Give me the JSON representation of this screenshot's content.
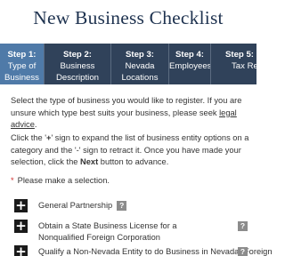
{
  "page": {
    "title": "New Business Checklist"
  },
  "steps": [
    {
      "label": "Step 1:",
      "name": "Type of Business",
      "active": true
    },
    {
      "label": "Step 2:",
      "name": "Business Description",
      "active": false
    },
    {
      "label": "Step 3:",
      "name": "Nevada Locations",
      "active": false
    },
    {
      "label": "Step 4:",
      "name": "Employees",
      "active": false
    },
    {
      "label": "Step 5:",
      "name": "Tax Requirements",
      "active": false
    }
  ],
  "intro": {
    "text": "Select the type of business you would like to register. If you are unsure which type best suits your business, please seek",
    "link": "legal advice",
    "after": "."
  },
  "instructions": {
    "part1": "Click the '",
    "plus": "+",
    "part2": "' sign to expand the list of business entity options on a category and the '-' sign to retract it. Once you have made your selection, click the",
    "next": "Next",
    "part3": "button to advance."
  },
  "required": {
    "star": "*",
    "text": "Please make a selection."
  },
  "options": [
    {
      "label": "General Partnership",
      "expand": "+",
      "help": "?"
    },
    {
      "label": "Obtain a State Business License for a Nonqualified Foreign Corporation",
      "expand": "+",
      "help": "?"
    },
    {
      "label": "Qualify a Non-Nevada Entity to do Business in Nevada (Foreign",
      "expand": "+",
      "help": "?"
    }
  ]
}
